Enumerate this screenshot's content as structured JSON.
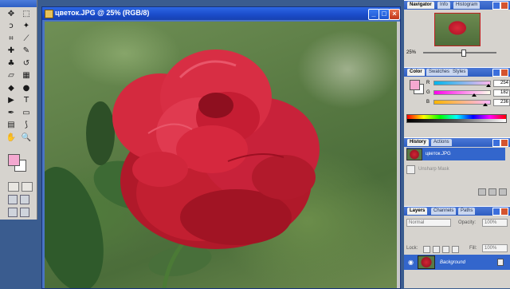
{
  "document": {
    "title": "цветок.JPG @ 25% (RGB/8)",
    "minimize": "_",
    "maximize": "□",
    "close": "×"
  },
  "toolbox": {
    "tools": [
      {
        "name": "move-icon",
        "glyph": "✥"
      },
      {
        "name": "marquee-icon",
        "glyph": "⬚"
      },
      {
        "name": "lasso-icon",
        "glyph": "ↄ"
      },
      {
        "name": "magic-wand-icon",
        "glyph": "✦"
      },
      {
        "name": "crop-icon",
        "glyph": "⌗"
      },
      {
        "name": "slice-icon",
        "glyph": "⟋"
      },
      {
        "name": "healing-brush-icon",
        "glyph": "✚"
      },
      {
        "name": "brush-icon",
        "glyph": "✎"
      },
      {
        "name": "clone-stamp-icon",
        "glyph": "♣"
      },
      {
        "name": "history-brush-icon",
        "glyph": "↺"
      },
      {
        "name": "eraser-icon",
        "glyph": "▱"
      },
      {
        "name": "gradient-icon",
        "glyph": "▦"
      },
      {
        "name": "blur-icon",
        "glyph": "◆"
      },
      {
        "name": "dodge-icon",
        "glyph": "●"
      },
      {
        "name": "path-selection-icon",
        "glyph": "▶"
      },
      {
        "name": "type-icon",
        "glyph": "T"
      },
      {
        "name": "pen-icon",
        "glyph": "✒"
      },
      {
        "name": "rectangle-icon",
        "glyph": "▭"
      },
      {
        "name": "notes-icon",
        "glyph": "▤"
      },
      {
        "name": "eyedropper-icon",
        "glyph": "⟆"
      },
      {
        "name": "hand-icon",
        "glyph": "✋"
      },
      {
        "name": "zoom-icon",
        "glyph": "🔍"
      }
    ],
    "foreground_color": "#f4a8d0",
    "background_color": "#ffffff"
  },
  "navigator": {
    "tabs": [
      "Navigator",
      "Info",
      "Histogram"
    ],
    "zoom": "25%",
    "zoom_fraction": 0.55
  },
  "color": {
    "tabs": [
      "Color",
      "Swatches",
      "Styles"
    ],
    "channels": [
      {
        "label": "R",
        "value": "254",
        "fraction": 0.99
      },
      {
        "label": "G",
        "value": "182",
        "fraction": 0.71
      },
      {
        "label": "B",
        "value": "236",
        "fraction": 0.93
      }
    ]
  },
  "history": {
    "tabs": [
      "History",
      "Actions"
    ],
    "items": [
      {
        "label": "цветок.JPG",
        "selected": true
      },
      {
        "label": "Unsharp Mask",
        "selected": false
      }
    ]
  },
  "layers": {
    "tabs": [
      "Layers",
      "Channels",
      "Paths"
    ],
    "blend_mode": "Normal",
    "opacity_label": "Opacity:",
    "opacity": "100%",
    "lock_label": "Lock:",
    "fill_label": "Fill:",
    "fill": "100%",
    "layer_name": "Background"
  }
}
